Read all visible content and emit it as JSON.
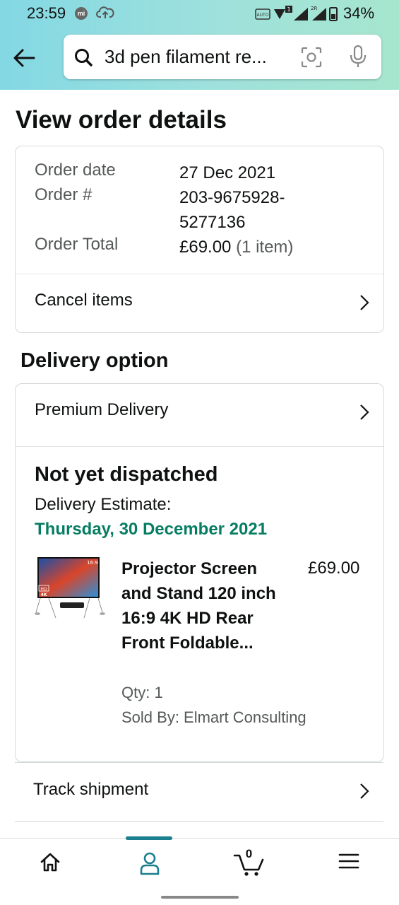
{
  "status_bar": {
    "time": "23:59",
    "battery": "34%"
  },
  "search": {
    "query": "3d pen filament re..."
  },
  "page": {
    "title": "View order details"
  },
  "order_summary": {
    "order_date_label": "Order date",
    "order_date": "27 Dec 2021",
    "order_number_label": "Order #",
    "order_number_line1": "203-9675928-",
    "order_number_line2": "5277136",
    "order_total_label": "Order Total",
    "order_total": "£69.00",
    "order_item_count": "(1 item)",
    "cancel_label": "Cancel items"
  },
  "delivery": {
    "section_title": "Delivery option",
    "option_label": "Premium Delivery",
    "status": "Not yet dispatched",
    "estimate_label": "Delivery Estimate:",
    "estimate_date": "Thursday, 30 December 2021",
    "product": {
      "title": "Projector Screen and Stand 120 inch 16:9 4K HD Rear Front Foldable...",
      "price": "£69.00",
      "qty": "Qty: 1",
      "sold_by": "Sold By: Elmart Consulting",
      "image_texts": {
        "ratio": "16:9",
        "hd": "HD",
        "k4": "4K"
      }
    },
    "track_label": "Track shipment"
  },
  "bottom_nav": {
    "cart_count": "0",
    "active": "account"
  },
  "colors": {
    "accent_teal": "#1a7f8e",
    "delivery_green": "#067d62",
    "header_start": "#83d8e4",
    "header_end": "#a6e6ce"
  }
}
